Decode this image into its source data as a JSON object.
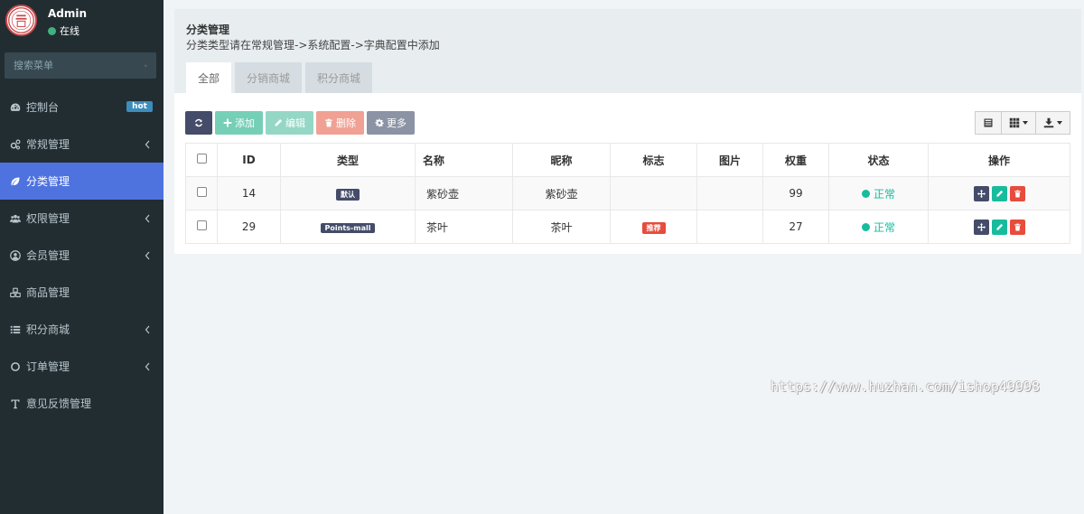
{
  "user": {
    "name": "Admin",
    "status": "在线"
  },
  "sidebar": {
    "search_placeholder": "搜索菜单",
    "items": [
      {
        "label": "控制台",
        "icon": "dashboard-icon",
        "badge": "hot"
      },
      {
        "label": "常规管理",
        "icon": "cogs-icon",
        "has_children": true
      },
      {
        "label": "分类管理",
        "icon": "leaf-icon",
        "active": true
      },
      {
        "label": "权限管理",
        "icon": "users-icon",
        "has_children": true
      },
      {
        "label": "会员管理",
        "icon": "user-circle-icon",
        "has_children": true
      },
      {
        "label": "商品管理",
        "icon": "cubes-icon"
      },
      {
        "label": "积分商城",
        "icon": "list-icon",
        "has_children": true
      },
      {
        "label": "订单管理",
        "icon": "circle-icon",
        "has_children": true
      },
      {
        "label": "意见反馈管理",
        "icon": "text-icon"
      }
    ]
  },
  "panel": {
    "title": "分类管理",
    "description": "分类类型请在常规管理->系统配置->字典配置中添加",
    "tabs": [
      {
        "label": "全部",
        "active": true
      },
      {
        "label": "分销商城"
      },
      {
        "label": "积分商城"
      }
    ]
  },
  "toolbar": {
    "add_label": "添加",
    "edit_label": "编辑",
    "delete_label": "删除",
    "more_label": "更多"
  },
  "table": {
    "headers": [
      "ID",
      "类型",
      "名称",
      "昵称",
      "标志",
      "图片",
      "权重",
      "状态",
      "操作"
    ],
    "rows": [
      {
        "id": "14",
        "type": "默认",
        "name": "紫砂壶",
        "nickname": "紫砂壶",
        "flag": "",
        "image": "",
        "weight": "99",
        "status": "正常"
      },
      {
        "id": "29",
        "type": "Points-mall",
        "name": "茶叶",
        "nickname": "茶叶",
        "flag": "推荐",
        "image": "",
        "weight": "27",
        "status": "正常"
      }
    ]
  },
  "watermark": "https://www.huzhan.com/ishop49998",
  "colors": {
    "sidebar_bg": "#222d32",
    "active_item": "#4e73df",
    "success": "#18bc9c",
    "danger": "#e74c3c",
    "dark": "#444c69"
  }
}
